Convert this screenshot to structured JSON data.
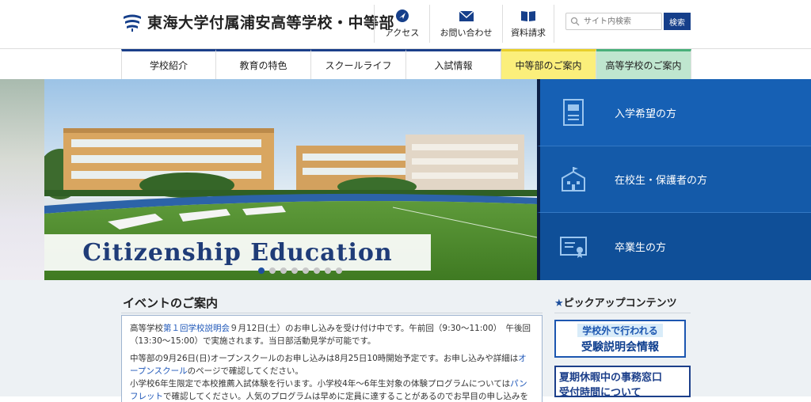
{
  "header": {
    "logo_text": "東海大学付属浦安高等学校・中等部",
    "utility_links": [
      {
        "label": "アクセス",
        "icon": "compass-icon"
      },
      {
        "label": "お問い合わせ",
        "icon": "mail-icon"
      },
      {
        "label": "資料請求",
        "icon": "book-icon"
      }
    ],
    "search": {
      "placeholder": "サイト内検索",
      "button_label": "検索"
    }
  },
  "nav": {
    "items": [
      "学校紹介",
      "教育の特色",
      "スクールライフ",
      "入試情報",
      "中等部のご案内",
      "高等学校のご案内"
    ]
  },
  "hero": {
    "caption": "Citizenship Education",
    "slide_count": 8,
    "active_slide": 1,
    "side_links": [
      {
        "label": "入学希望の方",
        "icon": "document-icon"
      },
      {
        "label": "在校生・保護者の方",
        "icon": "school-building-icon"
      },
      {
        "label": "卒業生の方",
        "icon": "certificate-icon"
      }
    ]
  },
  "events": {
    "title": "イベントのご案内",
    "p1_pre": "高等学校",
    "p1_link": "第１回学校説明会",
    "p1_post": "９月12日(土）のお申し込みを受け付け中です。午前回（9:30～11:00）　午後回（13:30～15:00）で実施されます。当日部活動見学が可能です。",
    "p2_pre": "中等部の9月26日(日)オープンスクールのお申し込みは8月25日10時開始予定です。お申し込みや詳細は",
    "p2_link": "オープンスクール",
    "p2_post": "のページで確認してください。",
    "p3_pre": "小学校6年生限定で本校推薦入試体験を行います。小学校4年～6年生対象の体験プログラムについては",
    "p3_link": "パンフレット",
    "p3_post": "で確認してください。人気のプログラムは早めに定員に達することがあるのでお早目の申し込みをお"
  },
  "pickup": {
    "title": "ピックアップコンテンツ",
    "banner1_line1": "学校外で行われる",
    "banner1_line2": "受験説明会情報",
    "banner2_line1": "夏期休暇中の事務窓口",
    "banner2_line2": "受付時間について"
  },
  "colors": {
    "brand": "#163f8a",
    "side_panel": "#1660b4",
    "junior_tab": "#fbef7b",
    "senior_tab": "#bfe6cf",
    "link": "#1d56b8"
  }
}
